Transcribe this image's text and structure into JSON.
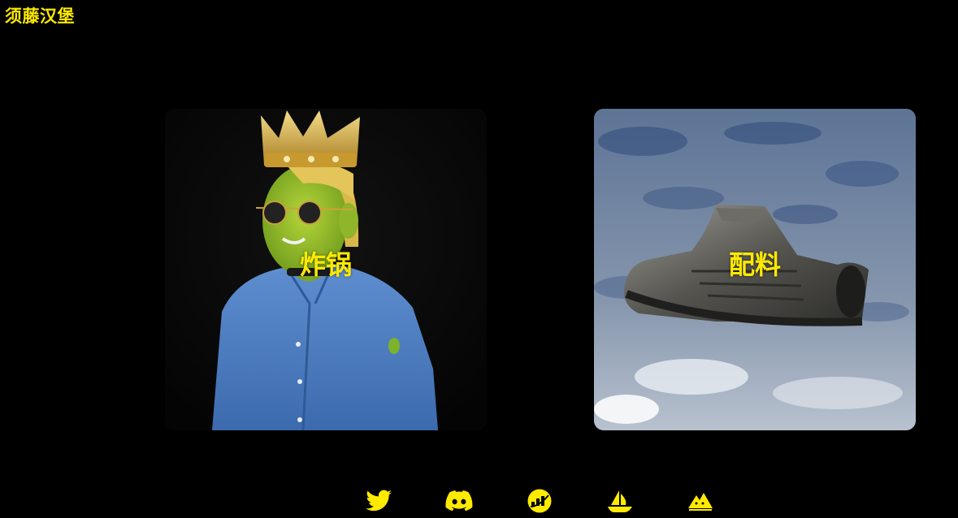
{
  "brand": {
    "title": "须藤汉堡"
  },
  "cards": [
    {
      "label": "炸锅",
      "image": "green-lizard-king-avatar"
    },
    {
      "label": "配料",
      "image": "leather-boot-on-ice"
    }
  ],
  "social": [
    {
      "icon": "twitter-icon"
    },
    {
      "icon": "discord-icon"
    },
    {
      "icon": "chart-icon"
    },
    {
      "icon": "boat-icon"
    },
    {
      "icon": "mountain-icon"
    }
  ],
  "colors": {
    "accent": "#ffea00",
    "background": "#000000"
  }
}
